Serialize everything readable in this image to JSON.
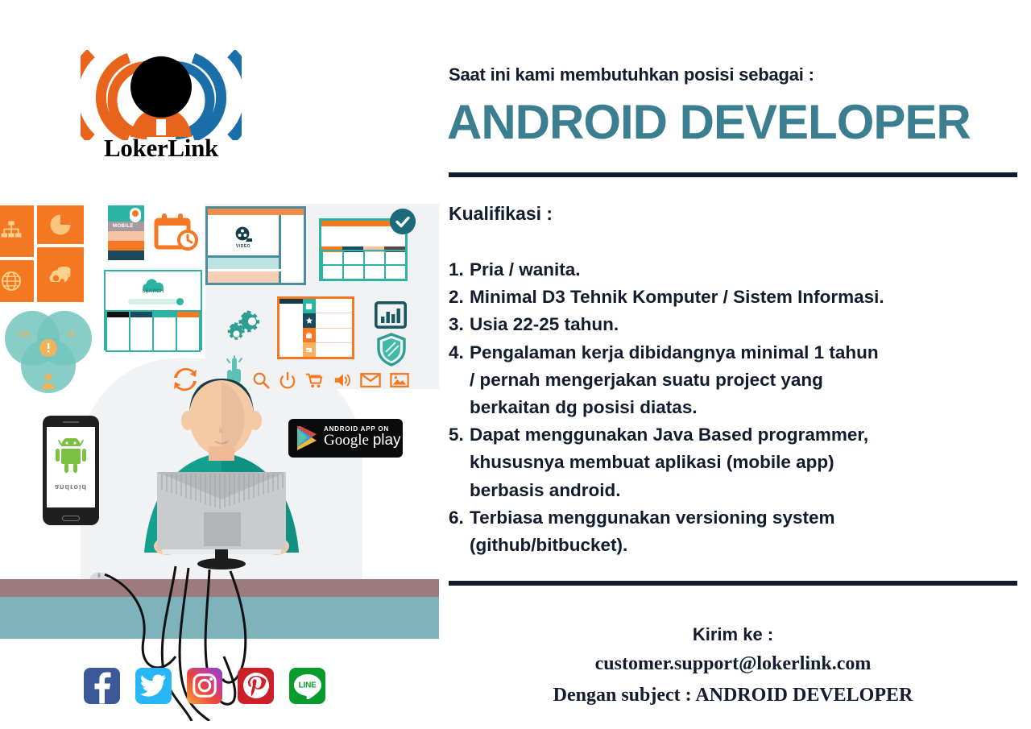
{
  "brand": {
    "logo_wordmark": "LokerLink",
    "logo_icon": "signal-waves-logo",
    "colors": {
      "orange": "#E8641C",
      "blue": "#1B6FA8",
      "teal": "#3A7E8F",
      "navy": "#111C2E"
    }
  },
  "header": {
    "eyebrow": "Saat ini kami membutuhkan  posisi sebagai :",
    "job_title": "ANDROID DEVELOPER"
  },
  "qualifications": {
    "heading": "Kualifikasi :",
    "items": [
      {
        "num": "1.",
        "text": "Pria  / wanita."
      },
      {
        "num": "2.",
        "text": "Minimal D3 Tehnik Komputer  / Sistem Informasi."
      },
      {
        "num": "3.",
        "text": "Usia 22-25 tahun."
      },
      {
        "num": "4.",
        "text": "Pengalaman kerja dibidangnya minimal 1 tahun\n/ pernah mengerjakan suatu  project  yang\nberkaitan dg posisi diatas."
      },
      {
        "num": "5.",
        "text": "Dapat menggunakan Java Based programmer,\nkhususnya membuat aplikasi (mobile app)\nberbasis android."
      },
      {
        "num": "6.",
        "text": "Terbiasa menggunakan versioning system\n(github/bitbucket)."
      }
    ]
  },
  "contact": {
    "send_to_label": "Kirim ke :",
    "email": "customer.support@lokerlink.com",
    "subject_line": "Dengan subject : ANDROID DEVELOPER"
  },
  "illustration": {
    "tiles": [
      {
        "icon": "sitemap-icon"
      },
      {
        "icon": "pie-chart-icon"
      },
      {
        "icon": "globe-icon"
      },
      {
        "icon": "cloud-gear-database-icon"
      }
    ],
    "swatch_card": {
      "label": "MOBILE",
      "icon": "location-pin-icon"
    },
    "calendar": {
      "icon": "calendar-clock-icon"
    },
    "search_panel": {
      "label": "SEARCH",
      "icon": "search-cloud-icon",
      "columns": 4
    },
    "video_window": {
      "label": "VIDEO",
      "icon": "film-reel-icon"
    },
    "table_window": {
      "badge_icon": "check-circle-icon"
    },
    "gears": {
      "icon": "gears-icon"
    },
    "chart_tile": {
      "icon": "bar-chart-icon"
    },
    "shield_tile": {
      "icon": "shield-icon"
    },
    "hand": {
      "icon": "pointing-hand-icon"
    },
    "refresh": {
      "icon": "refresh-arrows-icon"
    },
    "venn": {
      "labels": [
        "UX",
        "UI"
      ],
      "center_icon": "exclamation-icon",
      "bottom_icon": "user-icon"
    },
    "icon_row": [
      "search-icon",
      "power-icon",
      "shopping-cart-icon",
      "speaker-icon",
      "envelope-icon",
      "image-icon"
    ],
    "phone": {
      "os_name": "android",
      "icon": "android-robot-icon"
    },
    "google_play_badge": {
      "top_text": "ANDROID APP ON",
      "brand": "Google",
      "suffix": "play",
      "icon": "play-triangle-icon"
    },
    "person": {
      "icon": "developer-at-desk-illustration"
    }
  },
  "socials": [
    {
      "name": "facebook",
      "glyph": "f",
      "color": "#3B5998"
    },
    {
      "name": "twitter",
      "glyph": "bird",
      "color": "#29B6F6"
    },
    {
      "name": "instagram",
      "glyph": "camera",
      "color": "#E8453C"
    },
    {
      "name": "pinterest",
      "glyph": "P",
      "color": "#CB2027"
    },
    {
      "name": "line",
      "glyph": "LINE",
      "color": "#0A9B2D"
    }
  ]
}
